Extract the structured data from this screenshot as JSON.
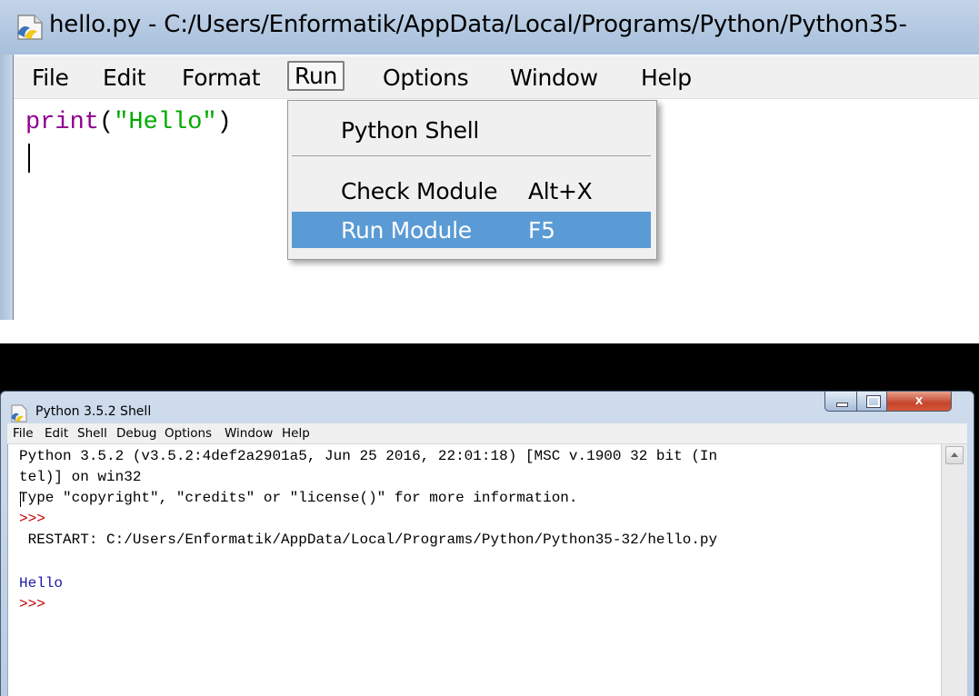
{
  "editor": {
    "title": "hello.py - C:/Users/Enformatik/AppData/Local/Programs/Python/Python35-",
    "menu": [
      "File",
      "Edit",
      "Format",
      "Run",
      "Options",
      "Window",
      "Help"
    ],
    "active_menu": "Run",
    "code": {
      "keyword": "print",
      "open": "(",
      "string": "\"Hello\"",
      "close": ")"
    },
    "run_menu": {
      "items": [
        {
          "label": "Python Shell",
          "accel": ""
        },
        {
          "label": "Check Module",
          "accel": "Alt+X"
        },
        {
          "label": "Run Module",
          "accel": "F5",
          "highlighted": true
        }
      ]
    }
  },
  "shell": {
    "title": "Python 3.5.2 Shell",
    "menu": [
      "File",
      "Edit",
      "Shell",
      "Debug",
      "Options",
      "Window",
      "Help"
    ],
    "lines": [
      "Python 3.5.2 (v3.5.2:4def2a2901a5, Jun 25 2016, 22:01:18) [MSC v.1900 32 bit (In",
      "tel)] on win32",
      "Type \"copyright\", \"credits\" or \"license()\" for more information.",
      ">>> ",
      " RESTART: C:/Users/Enformatik/AppData/Local/Programs/Python/Python35-32/hello.py",
      "",
      "Hello",
      ">>> "
    ],
    "controls": {
      "minimize": "minimize",
      "maximize": "maximize",
      "close": "x"
    }
  },
  "colors": {
    "keyword": "#900090",
    "string": "#00aa00",
    "prompt": "#c00000",
    "output": "#1a1aa6",
    "menu_highlight": "#5b9bd5"
  },
  "icons": [
    "python-file-icon",
    "minimize-icon",
    "maximize-icon",
    "close-icon",
    "scroll-up-icon"
  ]
}
